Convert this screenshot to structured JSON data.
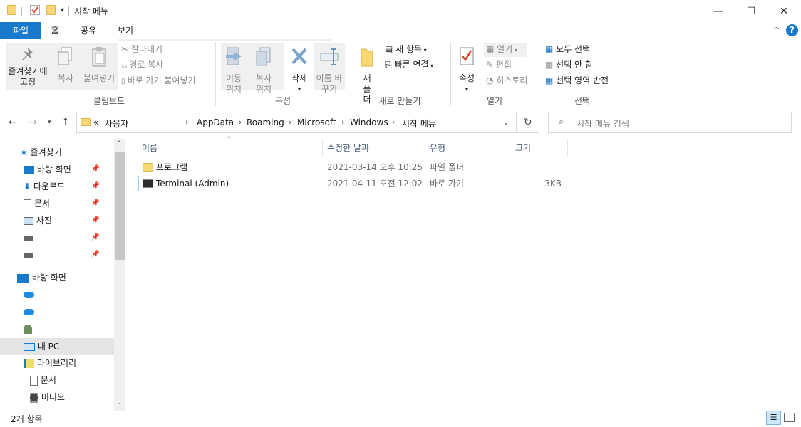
{
  "window": {
    "title": "시작 메뉴",
    "controls": {
      "minimize": "—",
      "maximize": "☐",
      "close": "✕"
    }
  },
  "tabs": [
    "파일",
    "홈",
    "공유",
    "보기"
  ],
  "ribbon": {
    "clipboard": {
      "pin": "즐겨찾기에 고정",
      "copy": "복사",
      "paste": "붙여넣기",
      "cut": "잘라내기",
      "copy_path": "경로 복사",
      "paste_shortcut": "바로 가기 붙여넣기",
      "label": "클립보드"
    },
    "organize": {
      "move_to": "이동 위치",
      "copy_to": "복사 위치",
      "delete": "삭제",
      "rename": "이름 바꾸기",
      "label": "구성"
    },
    "new": {
      "new_folder": "새 폴더",
      "new_item": "새 항목",
      "easy_access": "빠른 연결",
      "label": "새로 만들기"
    },
    "open": {
      "properties": "속성",
      "open": "열기",
      "edit": "편집",
      "history": "히스토리",
      "label": "열기"
    },
    "select": {
      "select_all": "모두 선택",
      "select_none": "선택 안 함",
      "invert": "선택 영역 반전",
      "label": "선택"
    }
  },
  "address": {
    "overflow": "«",
    "crumbs": [
      "사용자",
      "AppData",
      "Roaming",
      "Microsoft",
      "Windows",
      "시작 메뉴"
    ],
    "search_placeholder": "시작 메뉴 검색"
  },
  "sidebar": {
    "quick_access": "즐겨찾기",
    "pinned": [
      "바탕 화면",
      "다운로드",
      "문서",
      "사진"
    ],
    "desktop": "바탕 화면",
    "this_pc": "내 PC",
    "libraries": "라이브러리",
    "lib_items": [
      "문서",
      "비디오"
    ]
  },
  "columns": [
    "이름",
    "수정한 날짜",
    "유형",
    "크기"
  ],
  "files": [
    {
      "name": "프로그램",
      "modified": "2021-03-14 오후 10:25",
      "type": "파일 폴더",
      "size": ""
    },
    {
      "name": "Terminal (Admin)",
      "modified": "2021-04-11 오전 12:02",
      "type": "바로 가기",
      "size": "3KB"
    }
  ],
  "status": {
    "count": "2개 항목"
  },
  "colors": {
    "accent": "#1979ca",
    "folder": "#f8d775",
    "selection": "#e5e5e5",
    "focus_border": "#99d1ff"
  }
}
